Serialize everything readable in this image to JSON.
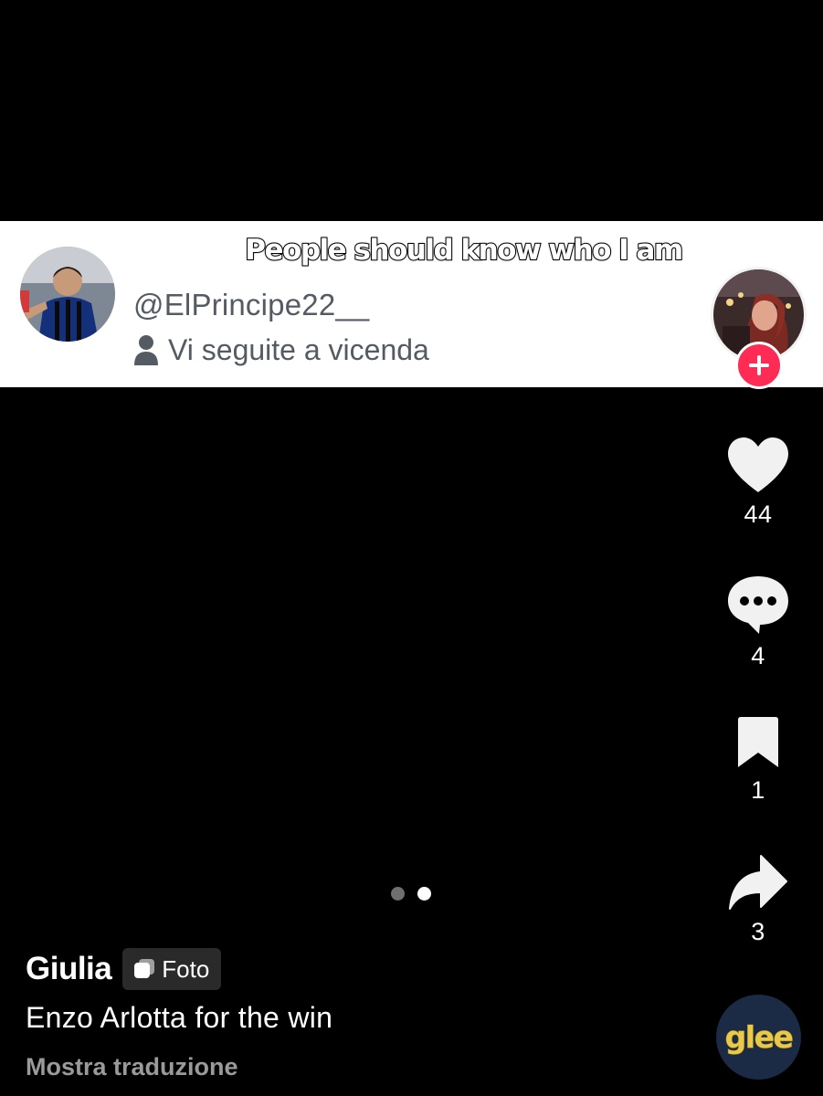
{
  "overlay": {
    "caption": "People should know who I am"
  },
  "profile_card": {
    "handle": "@ElPrincipe22__",
    "relationship": "Vi seguite a vicenda"
  },
  "actions": {
    "likes": "44",
    "comments": "4",
    "saves": "1",
    "shares": "3"
  },
  "carousel": {
    "total": 2,
    "active_index": 1
  },
  "post": {
    "author": "Giulia",
    "badge_label": "Foto",
    "caption": "Enzo Arlotta for the win",
    "translate_label": "Mostra traduzione"
  },
  "music": {
    "disc_label": "glee"
  },
  "icons": {
    "like": "heart-icon",
    "comment": "comment-bubble-icon",
    "save": "bookmark-icon",
    "share": "share-arrow-icon",
    "follow": "plus-icon",
    "relationship": "person-icon",
    "badge": "photo-stack-icon"
  },
  "colors": {
    "background": "#000000",
    "card": "#ffffff",
    "follow_button": "#fe2c55",
    "secondary_text": "#9a9a9a"
  }
}
